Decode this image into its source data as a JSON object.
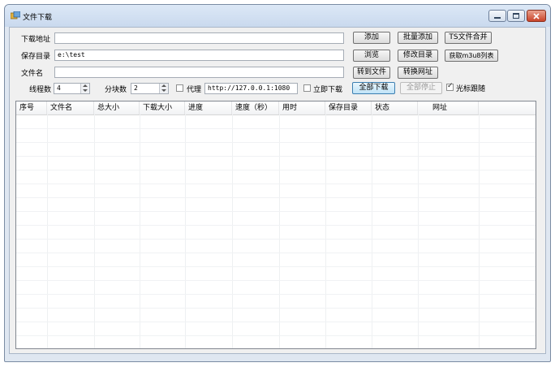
{
  "window": {
    "title": "文件下载"
  },
  "form": {
    "url_label": "下载地址",
    "url_value": "",
    "save_dir_label": "保存目录",
    "save_dir_value": "e:\\test",
    "filename_label": "文件名",
    "filename_value": "",
    "threads_label": "线程数",
    "threads_value": "4",
    "chunks_label": "分块数",
    "chunks_value": "2",
    "proxy_label": "代理",
    "proxy_checked": false,
    "proxy_value": "http://127.0.0.1:1080",
    "instant_label": "立即下载",
    "instant_checked": false,
    "cursor_follow_label": "光标跟随",
    "cursor_follow_checked": true
  },
  "buttons": {
    "add": "添加",
    "batch_add": "批量添加",
    "ts_merge": "TS文件合并",
    "browse": "浏览",
    "change_dir": "修改目录",
    "get_m3u8": "获取m3u8列表",
    "to_file": "转到文件",
    "to_url": "转换网址",
    "download_all": "全部下载",
    "stop_all": "全部停止"
  },
  "table": {
    "columns": [
      "序号",
      "文件名",
      "总大小",
      "下载大小",
      "进度",
      "速度（秒）",
      "用时",
      "保存目录",
      "状态",
      "网址"
    ],
    "rows": []
  },
  "colors": {
    "accent": "#3c7fb1",
    "close": "#c9442a"
  }
}
